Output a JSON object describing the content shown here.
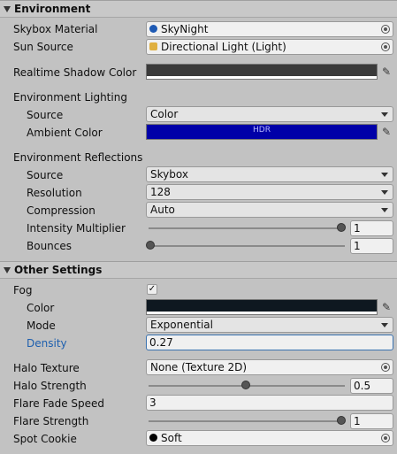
{
  "environment": {
    "header": "Environment",
    "skybox_label": "Skybox Material",
    "skybox_value": "SkyNight",
    "sun_label": "Sun Source",
    "sun_value": "Directional Light (Light)",
    "shadow_label": "Realtime Shadow Color",
    "shadow_color": "#3a3a3a",
    "lighting_label": "Environment Lighting",
    "lighting_source_label": "Source",
    "lighting_source_value": "Color",
    "ambient_label": "Ambient Color",
    "ambient_color": "#0000a8",
    "ambient_hdr": "HDR",
    "reflections_label": "Environment Reflections",
    "refl_source_label": "Source",
    "refl_source_value": "Skybox",
    "resolution_label": "Resolution",
    "resolution_value": "128",
    "compression_label": "Compression",
    "compression_value": "Auto",
    "intensity_label": "Intensity Multiplier",
    "intensity_value": "1",
    "bounces_label": "Bounces",
    "bounces_value": "1"
  },
  "other": {
    "header": "Other Settings",
    "fog_label": "Fog",
    "fog_checked": "✓",
    "fog_color_label": "Color",
    "fog_color": "#0e1820",
    "mode_label": "Mode",
    "mode_value": "Exponential",
    "density_label": "Density",
    "density_value": "0.27",
    "halo_texture_label": "Halo Texture",
    "halo_texture_value": "None (Texture 2D)",
    "halo_strength_label": "Halo Strength",
    "halo_strength_value": "0.5",
    "flare_fade_label": "Flare Fade Speed",
    "flare_fade_value": "3",
    "flare_strength_label": "Flare Strength",
    "flare_strength_value": "1",
    "spot_cookie_label": "Spot Cookie",
    "spot_cookie_value": "Soft"
  },
  "icons": {
    "eyedropper": "✎",
    "skybox": "sphere-icon",
    "sun": "directional-light-icon",
    "cookie": "black-circle-icon"
  }
}
